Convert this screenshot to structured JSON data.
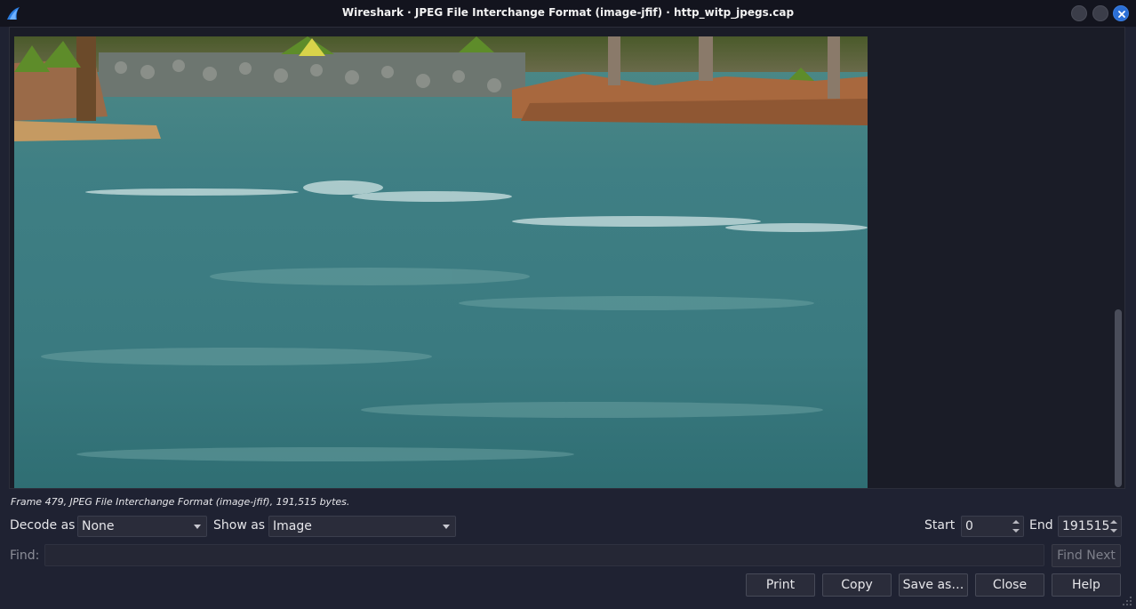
{
  "window": {
    "title": "Wireshark · JPEG File Interchange Format (image-jfif) · http_witp_jpegs.cap",
    "app_icon": "wireshark-fin-icon",
    "accent_color": "#2b6fd6"
  },
  "frame_info": "Frame 479, JPEG File Interchange Format (image-jfif), 191,515 bytes.",
  "controls": {
    "decode_as_label": "Decode as",
    "decode_as_value": "None",
    "show_as_label": "Show as",
    "show_as_value": "Image",
    "start_label": "Start",
    "start_value": "0",
    "end_label": "End",
    "end_value": "191515"
  },
  "find": {
    "label": "Find:",
    "value": "",
    "find_next_label": "Find Next"
  },
  "buttons": {
    "print": "Print",
    "copy": "Copy",
    "save_as": "Save as…",
    "close": "Close",
    "help": "Help"
  }
}
